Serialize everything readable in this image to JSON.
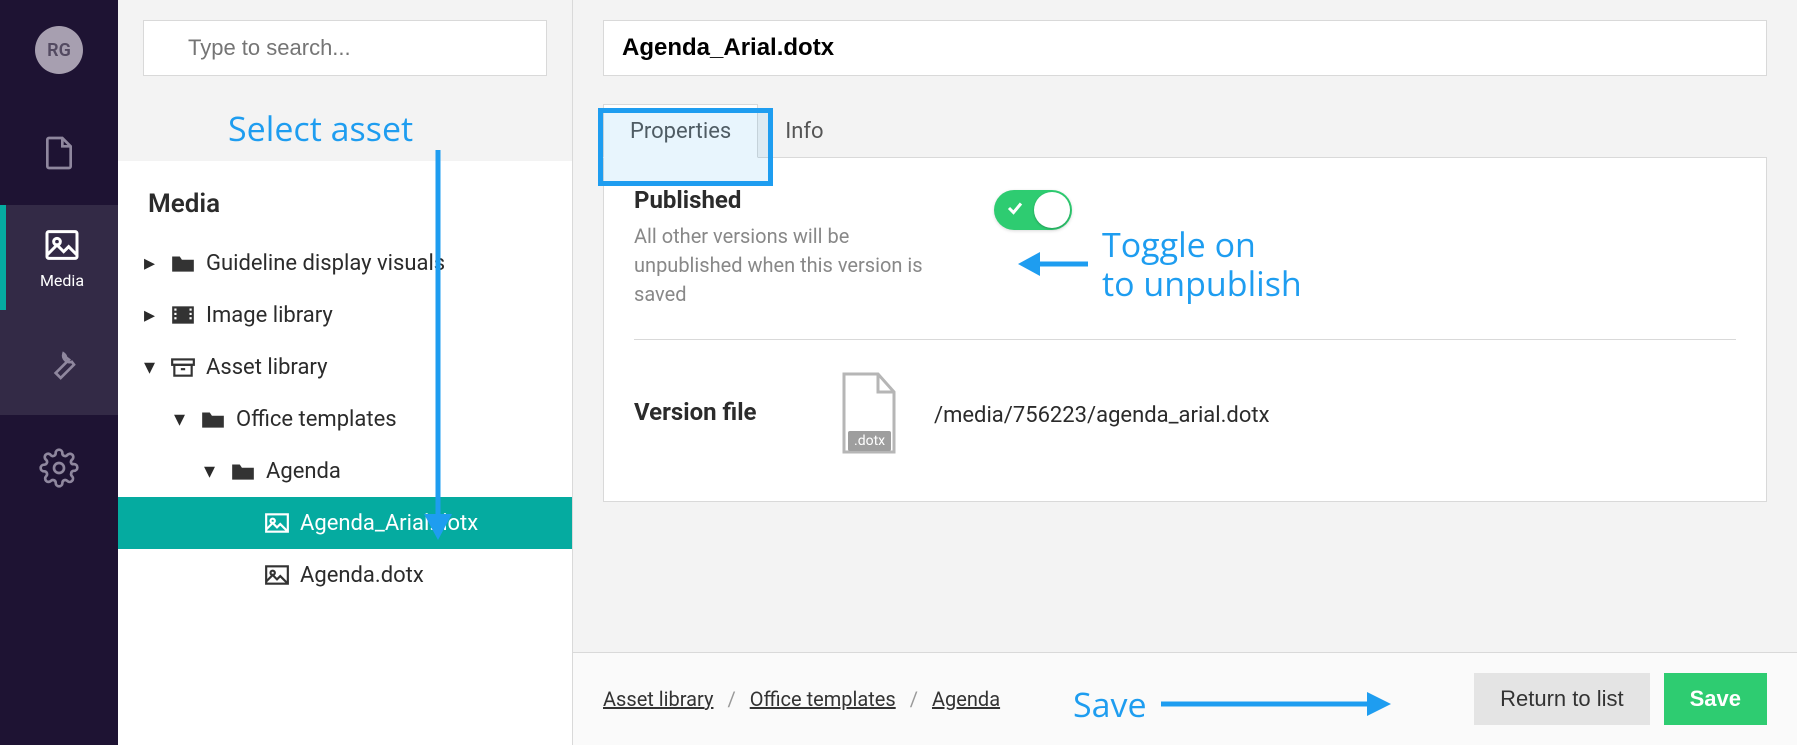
{
  "avatar_initials": "RG",
  "nav": {
    "media_label": "Media"
  },
  "search_placeholder": "Type to search...",
  "tree": {
    "heading": "Media",
    "items": [
      "Guideline display visuals",
      "Image library",
      "Asset library",
      "Office templates",
      "Agenda",
      "Agenda_Arial.dotx",
      "Agenda.dotx"
    ]
  },
  "detail": {
    "title": "Agenda_Arial.dotx",
    "tab_properties": "Properties",
    "tab_info": "Info",
    "published_label": "Published",
    "published_help": "All other versions will be unpublished when this version is saved",
    "version_label": "Version file",
    "version_ext": ".dotx",
    "version_path": "/media/756223/agenda_arial.dotx"
  },
  "footer": {
    "crumb1": "Asset library",
    "crumb2": "Office templates",
    "crumb3": "Agenda",
    "return": "Return to list",
    "save": "Save"
  },
  "annotations": {
    "select": "Select asset",
    "toggle_l1": "Toggle on",
    "toggle_l2": "to unpublish",
    "save": "Save"
  }
}
